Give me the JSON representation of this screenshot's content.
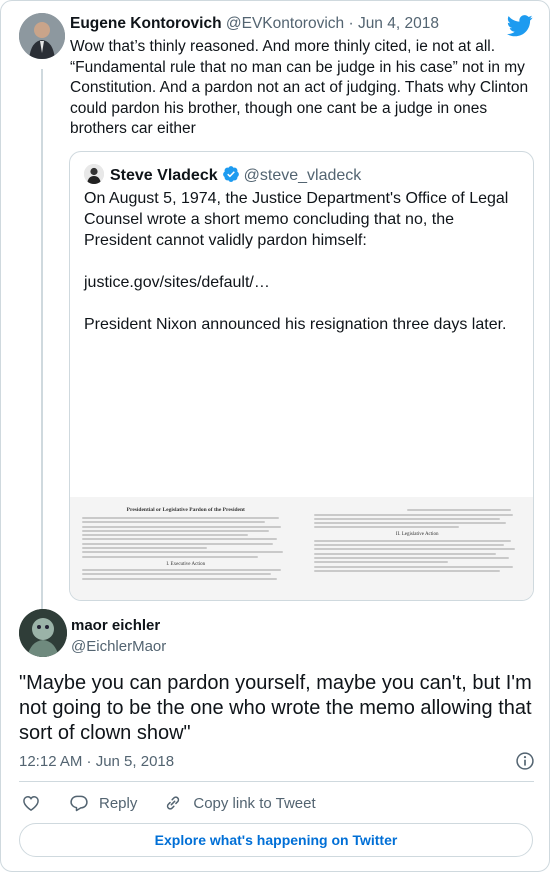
{
  "parent_tweet": {
    "name": "Eugene Kontorovich",
    "handle": "@EVKontorovich",
    "separator": " · ",
    "date": "Jun 4, 2018",
    "text": "Wow that’s thinly reasoned. And more thinly cited, ie not at all. “Fundamental rule that no man can be judge in his case” not in my Constitution. And a pardon not an act of judging. Thats why Clinton could pardon his brother, though one cant be a judge in ones brothers car either"
  },
  "quoted_tweet": {
    "name": "Steve Vladeck",
    "handle": "@steve_vladeck",
    "paragraphs": [
      "On August 5, 1974, the Justice Department's Office of Legal Counsel wrote a short memo concluding that no, the President cannot validly pardon himself:",
      "justice.gov/sites/default/…",
      "President Nixon announced his resignation three days later."
    ],
    "memo_left_title": "Presidential or Legislative Pardon of the President",
    "memo_left_subhead": "I. Executive Action",
    "memo_right_subhead": "II. Legislative Action"
  },
  "main_tweet": {
    "name": "maor eichler",
    "handle": "@EichlerMaor",
    "text": "\"Maybe you can pardon yourself, maybe you can't, but I'm not going to be the one who wrote the memo allowing that sort of clown show\"",
    "timestamp": "12:12 AM · Jun 5, 2018"
  },
  "actions": {
    "reply": "Reply",
    "copy_link": "Copy link to Tweet"
  },
  "footer": {
    "explore": "Explore what's happening on Twitter"
  },
  "colors": {
    "twitter_blue": "#1d9bf0",
    "link_blue": "#006fd6",
    "muted": "#536471",
    "border": "#cfd9de"
  },
  "icons": [
    "twitter-bird-icon",
    "verified-badge-icon",
    "info-icon",
    "heart-icon",
    "reply-bubble-icon",
    "link-icon"
  ]
}
